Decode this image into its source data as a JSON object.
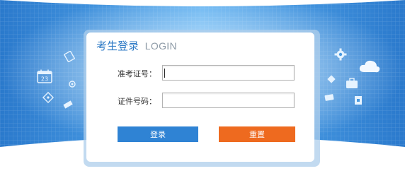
{
  "login_panel": {
    "title_cn": "考生登录",
    "title_en": "LOGIN"
  },
  "form": {
    "exam_id_label": "准考证号：",
    "exam_id_value": "",
    "id_number_label": "证件号码：",
    "id_number_value": ""
  },
  "buttons": {
    "login_label": "登录",
    "reset_label": "重置"
  },
  "colors": {
    "banner_blue": "#2e7fd0",
    "title_blue": "#2f7bc6",
    "login_button": "#2f83d4",
    "reset_button": "#ee6a1f"
  },
  "decorative_icons": {
    "left": [
      "calendar-icon",
      "cloud-icon",
      "book-icon",
      "pencil-icon",
      "gear-small-icon"
    ],
    "right": [
      "gear-icon",
      "cloud-icon",
      "diamond-icon",
      "briefcase-icon",
      "badge-icon",
      "notepad-icon"
    ]
  },
  "calendar_day": "23"
}
